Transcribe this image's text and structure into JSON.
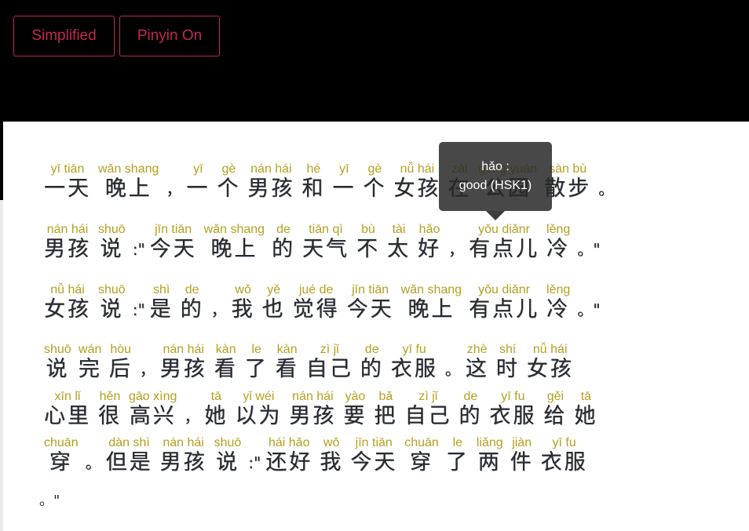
{
  "toolbar": {
    "simplified_label": "Simplified",
    "pinyin_label": "Pinyin On",
    "accent_color": "#c2294f"
  },
  "tooltip": {
    "word": "hǎo :",
    "definition": "good (HSK1)"
  },
  "lines": [
    [
      {
        "py": "yī tiān",
        "hz": "一天"
      },
      {
        "py": "wǎn shang",
        "hz": "晚上"
      },
      {
        "py": "",
        "hz": "，",
        "punct": true
      },
      {
        "py": "yī",
        "hz": "一"
      },
      {
        "py": "gè",
        "hz": "个"
      },
      {
        "py": "nán hái",
        "hz": "男孩"
      },
      {
        "py": "hé",
        "hz": "和"
      },
      {
        "py": "yī",
        "hz": "一"
      },
      {
        "py": "gè",
        "hz": "个"
      },
      {
        "py": "nǚ hái",
        "hz": "女孩"
      },
      {
        "py": "zài",
        "hz": "在"
      },
      {
        "py": "gōng yuán",
        "hz": "公园"
      },
      {
        "py": "sàn bù",
        "hz": "散步"
      },
      {
        "py": "",
        "hz": "。",
        "punct": true
      }
    ],
    [
      {
        "py": "nán hái",
        "hz": "男孩"
      },
      {
        "py": "shuō",
        "hz": "说"
      },
      {
        "py": "",
        "hz": ":\"",
        "punct": true
      },
      {
        "py": "jīn tiān",
        "hz": "今天"
      },
      {
        "py": "wǎn shang",
        "hz": "晚上"
      },
      {
        "py": "de",
        "hz": "的"
      },
      {
        "py": "tiān qì",
        "hz": "天气"
      },
      {
        "py": "bù",
        "hz": "不"
      },
      {
        "py": "tài",
        "hz": "太"
      },
      {
        "py": "hǎo",
        "hz": "好"
      },
      {
        "py": "",
        "hz": "，",
        "punct": true
      },
      {
        "py": "yǒu diǎnr",
        "hz": "有点儿"
      },
      {
        "py": "lěng",
        "hz": "冷"
      },
      {
        "py": "",
        "hz": "。\"",
        "punct": true
      }
    ],
    [
      {
        "py": "nǚ hái",
        "hz": "女孩"
      },
      {
        "py": "shuō",
        "hz": "说"
      },
      {
        "py": "",
        "hz": ":\"",
        "punct": true
      },
      {
        "py": "shì",
        "hz": "是"
      },
      {
        "py": "de",
        "hz": "的"
      },
      {
        "py": "",
        "hz": "，",
        "punct": true
      },
      {
        "py": "wǒ",
        "hz": "我"
      },
      {
        "py": "yě",
        "hz": "也"
      },
      {
        "py": "jué de",
        "hz": "觉得"
      },
      {
        "py": "jīn tiān",
        "hz": "今天"
      },
      {
        "py": "wǎn shang",
        "hz": "晚上"
      },
      {
        "py": "yǒu diǎnr",
        "hz": "有点儿"
      },
      {
        "py": "lěng",
        "hz": "冷"
      },
      {
        "py": "",
        "hz": "。\"",
        "punct": true
      }
    ],
    [
      {
        "py": "shuō",
        "hz": "说"
      },
      {
        "py": "wán",
        "hz": "完"
      },
      {
        "py": "hòu",
        "hz": "后"
      },
      {
        "py": "",
        "hz": "，",
        "punct": true
      },
      {
        "py": "nán hái",
        "hz": "男孩"
      },
      {
        "py": "kàn",
        "hz": "看"
      },
      {
        "py": "le",
        "hz": "了"
      },
      {
        "py": "kàn",
        "hz": "看"
      },
      {
        "py": "zì jǐ",
        "hz": "自己"
      },
      {
        "py": "de",
        "hz": "的"
      },
      {
        "py": "yī fu",
        "hz": "衣服"
      },
      {
        "py": "",
        "hz": "。",
        "punct": true
      },
      {
        "py": "zhè",
        "hz": "这"
      },
      {
        "py": "shí",
        "hz": "时"
      },
      {
        "py": "nǚ hái",
        "hz": "女孩"
      }
    ],
    [
      {
        "py": "xīn lǐ",
        "hz": "心里"
      },
      {
        "py": "hěn",
        "hz": "很"
      },
      {
        "py": "gāo xìng",
        "hz": "高兴"
      },
      {
        "py": "",
        "hz": "，",
        "punct": true
      },
      {
        "py": "tā",
        "hz": "她"
      },
      {
        "py": "yǐ wéi",
        "hz": "以为"
      },
      {
        "py": "nán hái",
        "hz": "男孩"
      },
      {
        "py": "yào",
        "hz": "要"
      },
      {
        "py": "bǎ",
        "hz": "把"
      },
      {
        "py": "zì jǐ",
        "hz": "自己"
      },
      {
        "py": "de",
        "hz": "的"
      },
      {
        "py": "yī fu",
        "hz": "衣服"
      },
      {
        "py": "gěi",
        "hz": "给"
      },
      {
        "py": "tā",
        "hz": "她"
      }
    ],
    [
      {
        "py": "chuān",
        "hz": "穿"
      },
      {
        "py": "",
        "hz": "。",
        "punct": true
      },
      {
        "py": "dàn shì",
        "hz": "但是"
      },
      {
        "py": "nán hái",
        "hz": "男孩"
      },
      {
        "py": "shuō",
        "hz": "说"
      },
      {
        "py": "",
        "hz": ":\"",
        "punct": true
      },
      {
        "py": "hái hǎo",
        "hz": "还好"
      },
      {
        "py": "wǒ",
        "hz": "我"
      },
      {
        "py": "jīn tiān",
        "hz": "今天"
      },
      {
        "py": "chuān",
        "hz": "穿"
      },
      {
        "py": "le",
        "hz": "了"
      },
      {
        "py": "liǎng",
        "hz": "两"
      },
      {
        "py": "jiàn",
        "hz": "件"
      },
      {
        "py": "yī fu",
        "hz": "衣服"
      }
    ]
  ],
  "tail": "。\""
}
